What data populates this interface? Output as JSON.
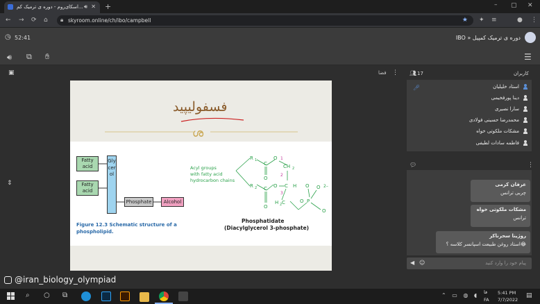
{
  "browser": {
    "tab_title": "اسکای‌روم - دوره ی ترمیک کم...",
    "url": "skyroom.online/ch/ibo/campbell"
  },
  "header": {
    "timer": "52:41",
    "room_title": "IBO » دوره ی ترمیک کمپیل"
  },
  "stage": {
    "label": "فضا",
    "slide_title": "فسفولیپید",
    "figure_caption_line1": "Figure 12.3  Schematic structure of a",
    "figure_caption_line2": "phospholipid.",
    "fatty_acid": "Fatty acid",
    "glycerol": "Glycerol",
    "phosphate": "Phosphate",
    "alcohol": "Alcohol",
    "acyl_groups_1": "Acyl groups",
    "acyl_groups_2": "with fatty acid",
    "acyl_groups_3": "hydrocarbon chains",
    "phosphatidate": "Phosphatidate",
    "phosphatidate_sub": "(Diacylglycerol 3-phosphate)",
    "r1": "R",
    "r2": "R",
    "n1": "1",
    "n2": "2",
    "n3": "3",
    "charge": "2–"
  },
  "users": {
    "title": "کاربران",
    "count": "17",
    "list": [
      "استاد خلیلیان",
      "دینا پورفخیمی",
      "سارا نصیری",
      "محمدرضا حسینی فولادی",
      "مشکات ملکوتی خواه",
      "فاطمه سادات لطیفی"
    ]
  },
  "chat": {
    "messages": [
      {
        "name": "عرفان کرمی",
        "text": "چربی ترانس"
      },
      {
        "name": "مشکات ملکوتی خواه",
        "text": "ترانس"
      },
      {
        "name": "روژینا سحرناکر",
        "text": "استاد روغن طبیعت اسپانسر کلاسه ؟😂"
      }
    ],
    "input_placeholder": "پیام خود را وارد کنید"
  },
  "watermark": "@iran_biology_olympiad",
  "taskbar": {
    "time": "5:41 PM",
    "date": "7/7/2022",
    "lang1": "FA",
    "lang2": "فا"
  }
}
